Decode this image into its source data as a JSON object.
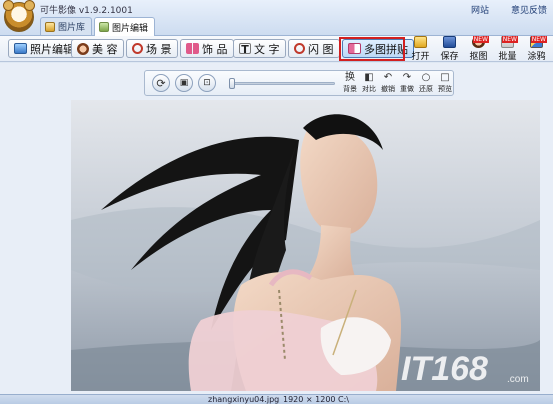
{
  "app": {
    "title": "可牛影像 v1.9.2.1001",
    "links": [
      "网站",
      "意见反馈"
    ],
    "tabs": [
      {
        "label": "图片库",
        "active": false
      },
      {
        "label": "图片编辑",
        "active": true
      }
    ]
  },
  "toolbar": {
    "buttons": [
      {
        "label": "照片编辑",
        "icon": "photo-edit-icon"
      },
      {
        "label": "美 容",
        "icon": "beauty-icon"
      },
      {
        "label": "场 景",
        "icon": "scene-icon"
      },
      {
        "label": "饰 品",
        "icon": "accessory-icon"
      },
      {
        "label": "文 字",
        "icon": "text-icon"
      },
      {
        "label": "闪 图",
        "icon": "flash-icon"
      },
      {
        "label": "多图拼贴",
        "icon": "collage-icon",
        "selected": true
      }
    ],
    "right_tools": [
      {
        "label": "打开",
        "icon": "open-folder-icon"
      },
      {
        "label": "保存",
        "icon": "save-icon"
      },
      {
        "label": "抠图",
        "icon": "cutout-icon",
        "badge": "NEW"
      },
      {
        "label": "批量",
        "icon": "batch-icon",
        "badge": "NEW"
      },
      {
        "label": "涂鸦",
        "icon": "doodle-icon",
        "badge": "NEW"
      }
    ]
  },
  "view_controls": {
    "round_buttons": [
      "rotate-icon",
      "fit-screen-icon",
      "actual-size-icon"
    ],
    "zoom_level": 0,
    "actions": [
      {
        "label": "背景",
        "glyph": "换"
      },
      {
        "label": "对比",
        "glyph": "◧"
      },
      {
        "label": "撤销",
        "glyph": "↶"
      },
      {
        "label": "重做",
        "glyph": "↷"
      },
      {
        "label": "还原",
        "glyph": "○"
      },
      {
        "label": "预览",
        "glyph": "□"
      }
    ]
  },
  "photo": {
    "watermark": "IT168",
    "watermark_sub": ".com"
  },
  "status": {
    "filename": "zhangxinyu04.jpg",
    "resolution": "1920 × 1200",
    "path": "C:\\"
  },
  "colors": {
    "accent": "#4f7bb4",
    "selection": "#d21f1f",
    "badge": "#dd2222"
  }
}
